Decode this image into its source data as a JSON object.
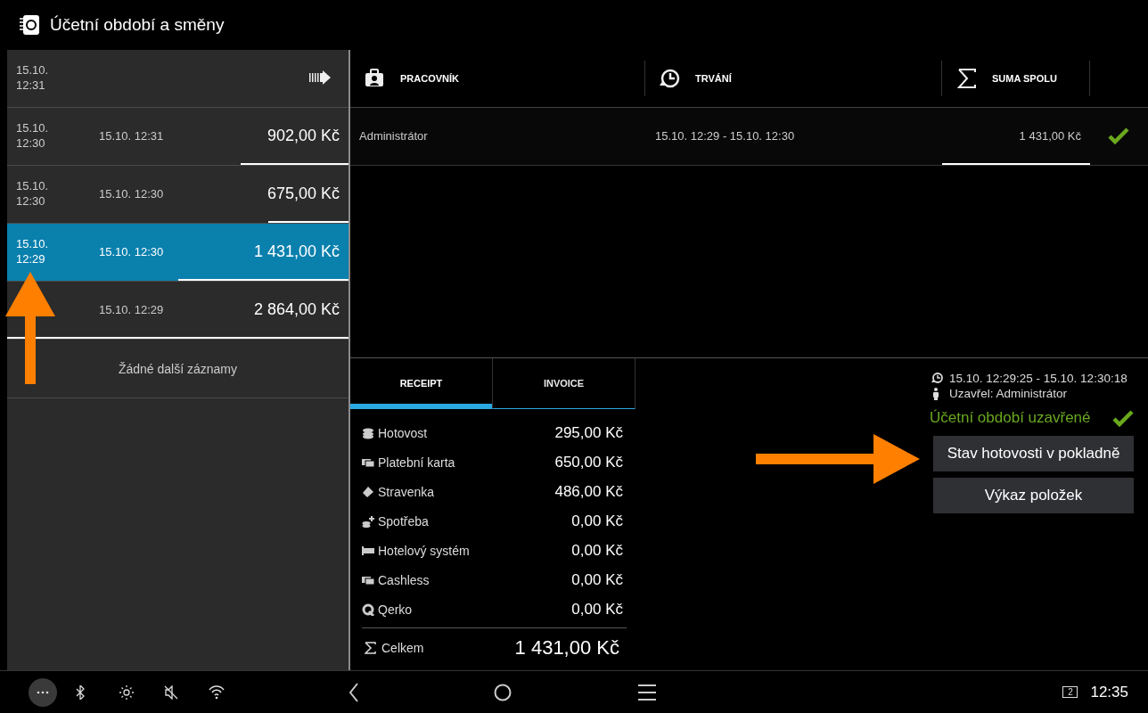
{
  "window": {
    "title": "Účetní období a směny"
  },
  "shifts": {
    "rows": [
      {
        "kind": "current",
        "start_date": "15.10.",
        "start_time": "12:31",
        "selected": false
      },
      {
        "kind": "closed",
        "start_date": "15.10.",
        "start_time": "12:30",
        "end": "15.10. 12:31",
        "amount": "902,00 Kč",
        "level": 0.315,
        "selected": false
      },
      {
        "kind": "closed",
        "start_date": "15.10.",
        "start_time": "12:30",
        "end": "15.10. 12:30",
        "amount": "675,00 Kč",
        "level": 0.236,
        "selected": false
      },
      {
        "kind": "closed",
        "start_date": "15.10.",
        "start_time": "12:29",
        "end": "15.10. 12:30",
        "amount": "1 431,00 Kč",
        "level": 0.5,
        "selected": true
      },
      {
        "kind": "closed",
        "end": "15.10. 12:29",
        "amount": "2 864,00 Kč",
        "level": 1,
        "selected": false
      }
    ],
    "footer": "Žádné další záznamy"
  },
  "workers": {
    "columns": [
      {
        "kind": "worker",
        "label": "PRACOVNÍK"
      },
      {
        "kind": "duration",
        "label": "TRVÁNÍ"
      },
      {
        "kind": "sum",
        "label": "SUMA SPOLU"
      }
    ],
    "rows": [
      {
        "worker": "Administrátor",
        "duration": "15.10. 12:29 - 15.10. 12:30",
        "total": "1 431,00 Kč",
        "closed": true
      }
    ]
  },
  "detail": {
    "tabs": [
      {
        "label": "RECEIPT",
        "selected": true
      },
      {
        "label": "INVOICE",
        "selected": false
      }
    ],
    "payments": [
      {
        "kind": "cash",
        "label": "Hotovost",
        "amount": "295,00 Kč"
      },
      {
        "kind": "card",
        "label": "Platební karta",
        "amount": "650,00 Kč"
      },
      {
        "kind": "voucher",
        "label": "Stravenka",
        "amount": "486,00 Kč"
      },
      {
        "kind": "consumption",
        "label": "Spotřeba",
        "amount": "0,00 Kč"
      },
      {
        "kind": "hotel",
        "label": "Hotelový systém",
        "amount": "0,00 Kč"
      },
      {
        "kind": "card",
        "label": "Cashless",
        "amount": "0,00 Kč"
      },
      {
        "kind": "qerko",
        "label": "Qerko",
        "amount": "0,00 Kč"
      }
    ],
    "total": {
      "label": "Celkem",
      "amount": "1 431,00 Kč"
    }
  },
  "period": {
    "range": "15.10. 12:29:25 - 15.10. 12:30:18",
    "closed_by": "Uzavřel: Administrátor",
    "status": {
      "label": "Účetní období uzavřené",
      "closed": true
    },
    "buttons": [
      "Stav hotovosti v pokladně",
      "Výkaz položek"
    ]
  },
  "status_bar": {
    "notification_count": "2",
    "time": "12:35"
  }
}
